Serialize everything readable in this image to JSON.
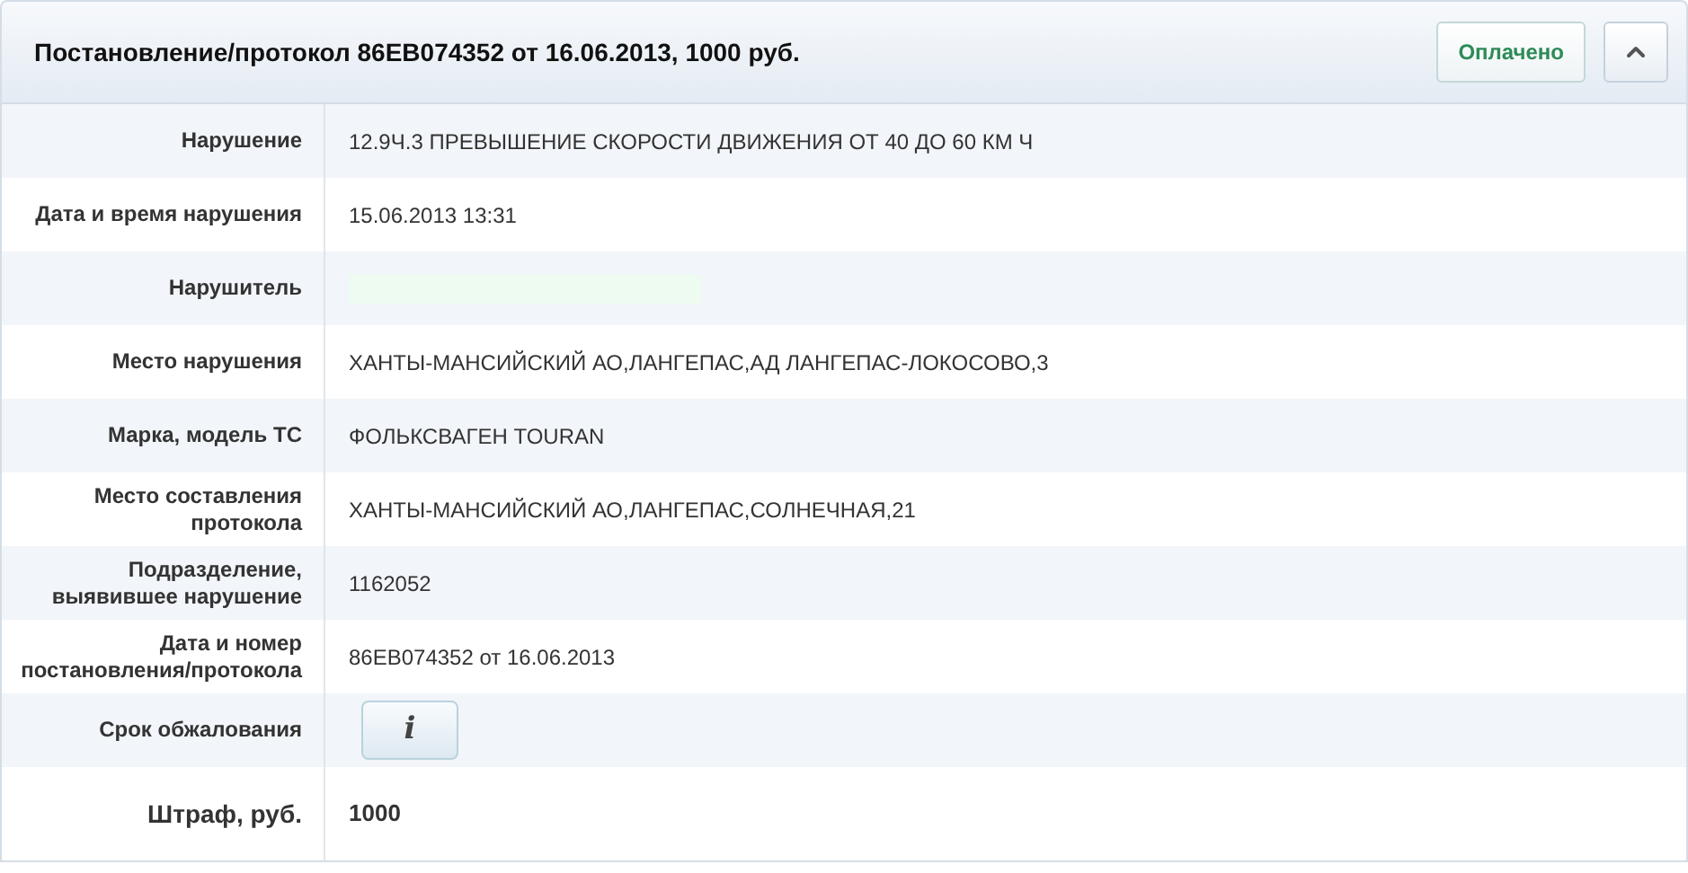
{
  "header": {
    "title": "Постановление/протокол 86ЕВ074352 от 16.06.2013, 1000 руб.",
    "status": "Оплачено",
    "expanded": true
  },
  "rows": [
    {
      "kind": "text",
      "label": "Нарушение",
      "value": "12.9Ч.3 ПРЕВЫШЕНИЕ СКОРОСТИ ДВИЖЕНИЯ ОТ 40 ДО 60 КМ Ч"
    },
    {
      "kind": "text",
      "label": "Дата и время нарушения",
      "value": "15.06.2013 13:31"
    },
    {
      "kind": "redacted",
      "label": "Нарушитель"
    },
    {
      "kind": "text",
      "label": "Место нарушения",
      "value": "ХАНТЫ-МАНСИЙСКИЙ АО,ЛАНГЕПАС,АД ЛАНГЕПАС-ЛОКОСОВО,3"
    },
    {
      "kind": "text",
      "label": "Марка, модель ТС",
      "value": "ФОЛЬКСВАГЕН TOURAN"
    },
    {
      "kind": "text",
      "label": "Место составления протокола",
      "value": "ХАНТЫ-МАНСИЙСКИЙ АО,ЛАНГЕПАС,СОЛНЕЧНАЯ,21"
    },
    {
      "kind": "text",
      "label": "Подразделение, выявившее нарушение",
      "value": "1162052"
    },
    {
      "kind": "text",
      "label": "Дата и номер постановления/протокола",
      "value": "86ЕВ074352 от 16.06.2013"
    },
    {
      "kind": "info",
      "label": "Срок обжалования",
      "value": "i"
    },
    {
      "kind": "total",
      "label": "Штраф, руб.",
      "value": "1000"
    }
  ]
}
